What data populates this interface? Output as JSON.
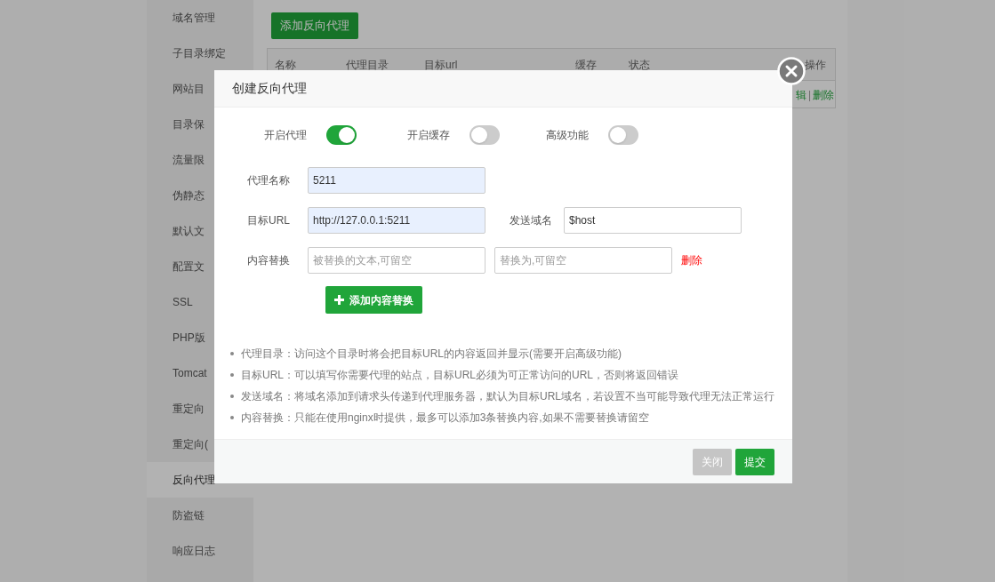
{
  "sidebar": {
    "items": [
      {
        "label": "域名管理",
        "selected": false
      },
      {
        "label": "子目录绑定",
        "selected": false
      },
      {
        "label": "网站目",
        "selected": false
      },
      {
        "label": "目录保",
        "selected": false
      },
      {
        "label": "流量限",
        "selected": false
      },
      {
        "label": "伪静态",
        "selected": false
      },
      {
        "label": "默认文",
        "selected": false
      },
      {
        "label": "配置文",
        "selected": false
      },
      {
        "label": "SSL",
        "selected": false
      },
      {
        "label": "PHP版",
        "selected": false
      },
      {
        "label": "Tomcat",
        "selected": false
      },
      {
        "label": "重定向",
        "selected": false
      },
      {
        "label": "重定向(",
        "selected": false
      },
      {
        "label": "反向代理",
        "selected": true
      },
      {
        "label": "防盗链",
        "selected": false
      },
      {
        "label": "响应日志",
        "selected": false
      }
    ]
  },
  "add_proxy_button": "添加反向代理",
  "table": {
    "columns": [
      "名称",
      "代理目录",
      "目标url",
      "缓存",
      "状态",
      "操作"
    ],
    "rows": [
      {
        "actions": [
          "辑",
          "删除"
        ],
        "separator": "|"
      }
    ]
  },
  "dialog": {
    "title": "创建反向代理",
    "toggles": [
      {
        "label": "开启代理",
        "on": true
      },
      {
        "label": "开启缓存",
        "on": false
      },
      {
        "label": "高级功能",
        "on": false
      }
    ],
    "proxy_name": {
      "label": "代理名称",
      "value": "5211",
      "autofilled": true
    },
    "target_url": {
      "label": "目标URL",
      "value": "http://127.0.0.1:5211",
      "autofilled": true
    },
    "send_domain": {
      "label": "发送域名",
      "value": "$host",
      "autofilled": false
    },
    "content_replace": {
      "label": "内容替换",
      "placeholders": [
        "被替换的文本,可留空",
        "替换为,可留空"
      ],
      "delete": "删除"
    },
    "add_replace_button": "添加内容替换",
    "notes": [
      "代理目录：访问这个目录时将会把目标URL的内容返回并显示(需要开启高级功能)",
      "目标URL：可以填写你需要代理的站点，目标URL必须为可正常访问的URL，否则将返回错误",
      "发送域名：将域名添加到请求头传递到代理服务器，默认为目标URL域名，若设置不当可能导致代理无法正常运行",
      "内容替换：只能在使用nginx时提供，最多可以添加3条替换内容,如果不需要替换请留空"
    ],
    "buttons": [
      {
        "label": "关闭",
        "kind": "secondary"
      },
      {
        "label": "提交",
        "kind": "primary"
      }
    ]
  }
}
